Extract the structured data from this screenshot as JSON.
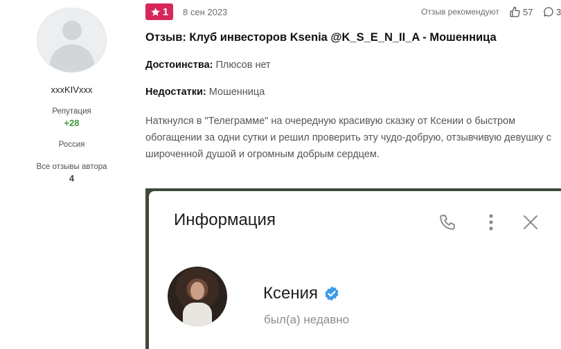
{
  "author": {
    "name": "xxxKIVxxx",
    "reputation_label": "Репутация",
    "reputation_value": "+28",
    "country": "Россия",
    "all_reviews_label": "Все отзывы автора",
    "all_reviews_count": "4"
  },
  "review": {
    "rating": "1",
    "rating_color": "#d7265c",
    "date": "8 сен 2023",
    "recommend_label": "Отзыв рекомендуют",
    "likes": "57",
    "comments": "3",
    "title": "Отзыв: Клуб инвесторов Ksenia @K_S_E_N_II_A - Мошенница",
    "pros_label": "Достоинства:",
    "pros_value": "Плюсов нет",
    "cons_label": "Недостатки:",
    "cons_value": "Мошенница",
    "body": "Наткнулся в \"Телеграмме\" на очередную красивую сказку от Ксении о быстром обогащении за одни сутки и решил проверить эту чудо-добрую, отзывчивую девушку с широченной душой и огромным добрым сердцем."
  },
  "screenshot": {
    "header_title": "Информация",
    "contact_name": "Ксения",
    "contact_status": "был(а) недавно",
    "verified_color": "#3d9be9",
    "icons": [
      "phone-icon",
      "more-vertical-icon",
      "close-icon",
      "verified-icon"
    ]
  },
  "colors": {
    "reputation": "#3b9b3b",
    "badge": "#d7265c"
  }
}
